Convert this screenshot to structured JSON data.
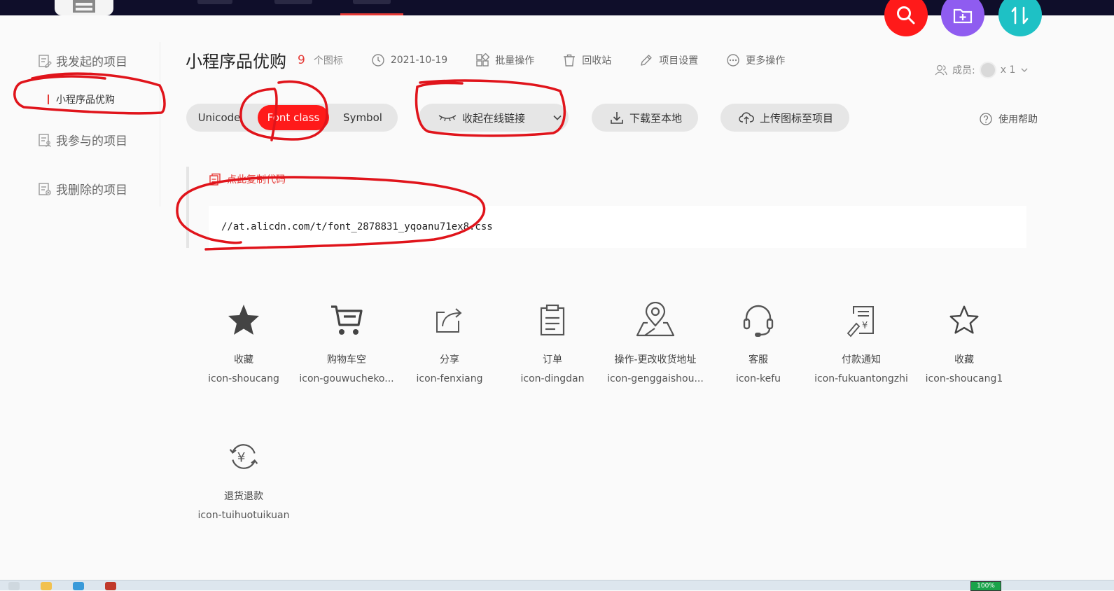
{
  "sidebar": {
    "initiated": "我发起的项目",
    "current_project": "小程序品优购",
    "participated": "我参与的项目",
    "deleted": "我删除的项目"
  },
  "header": {
    "project_title": "小程序品优购",
    "icon_count": "9",
    "icon_count_unit": "个图标",
    "date": "2021-10-19",
    "batch": "批量操作",
    "recycle": "回收站",
    "settings": "项目设置",
    "more": "更多操作",
    "members_label": "成员:",
    "members_count": "x 1"
  },
  "toolbar": {
    "tabs": [
      "Unicode",
      "Font class",
      "Symbol"
    ],
    "active_tab": "Font class",
    "collapse_link": "收起在线链接",
    "download": "下载至本地",
    "upload": "上传图标至项目",
    "help": "使用帮助"
  },
  "code": {
    "copy_label": "点此复制代码",
    "url": "//at.alicdn.com/t/font_2878831_yqoanu71ex8.css"
  },
  "icons": [
    {
      "name": "收藏",
      "class": "icon-shoucang",
      "icon": "star-filled-icon"
    },
    {
      "name": "购物车空",
      "class": "icon-gouwucheko...",
      "icon": "cart-icon"
    },
    {
      "name": "分享",
      "class": "icon-fenxiang",
      "icon": "share-icon"
    },
    {
      "name": "订单",
      "class": "icon-dingdan",
      "icon": "clipboard-icon"
    },
    {
      "name": "操作-更改收货地址",
      "class": "icon-genggaishou...",
      "icon": "map-pin-icon"
    },
    {
      "name": "客服",
      "class": "icon-kefu",
      "icon": "headset-icon"
    },
    {
      "name": "付款通知",
      "class": "icon-fukuantongzhi",
      "icon": "payment-notice-icon"
    },
    {
      "name": "收藏",
      "class": "icon-shoucang1",
      "icon": "star-outline-icon"
    },
    {
      "name": "退货退款",
      "class": "icon-tuihuotuikuan",
      "icon": "refund-icon"
    }
  ],
  "taskbar": {
    "battery": "100%"
  },
  "colors": {
    "accent": "#ff1a1a",
    "purple": "#8f5cf0",
    "teal": "#1ec1c5",
    "topbar": "#0f0e2a",
    "annotation": "#e0141b"
  }
}
